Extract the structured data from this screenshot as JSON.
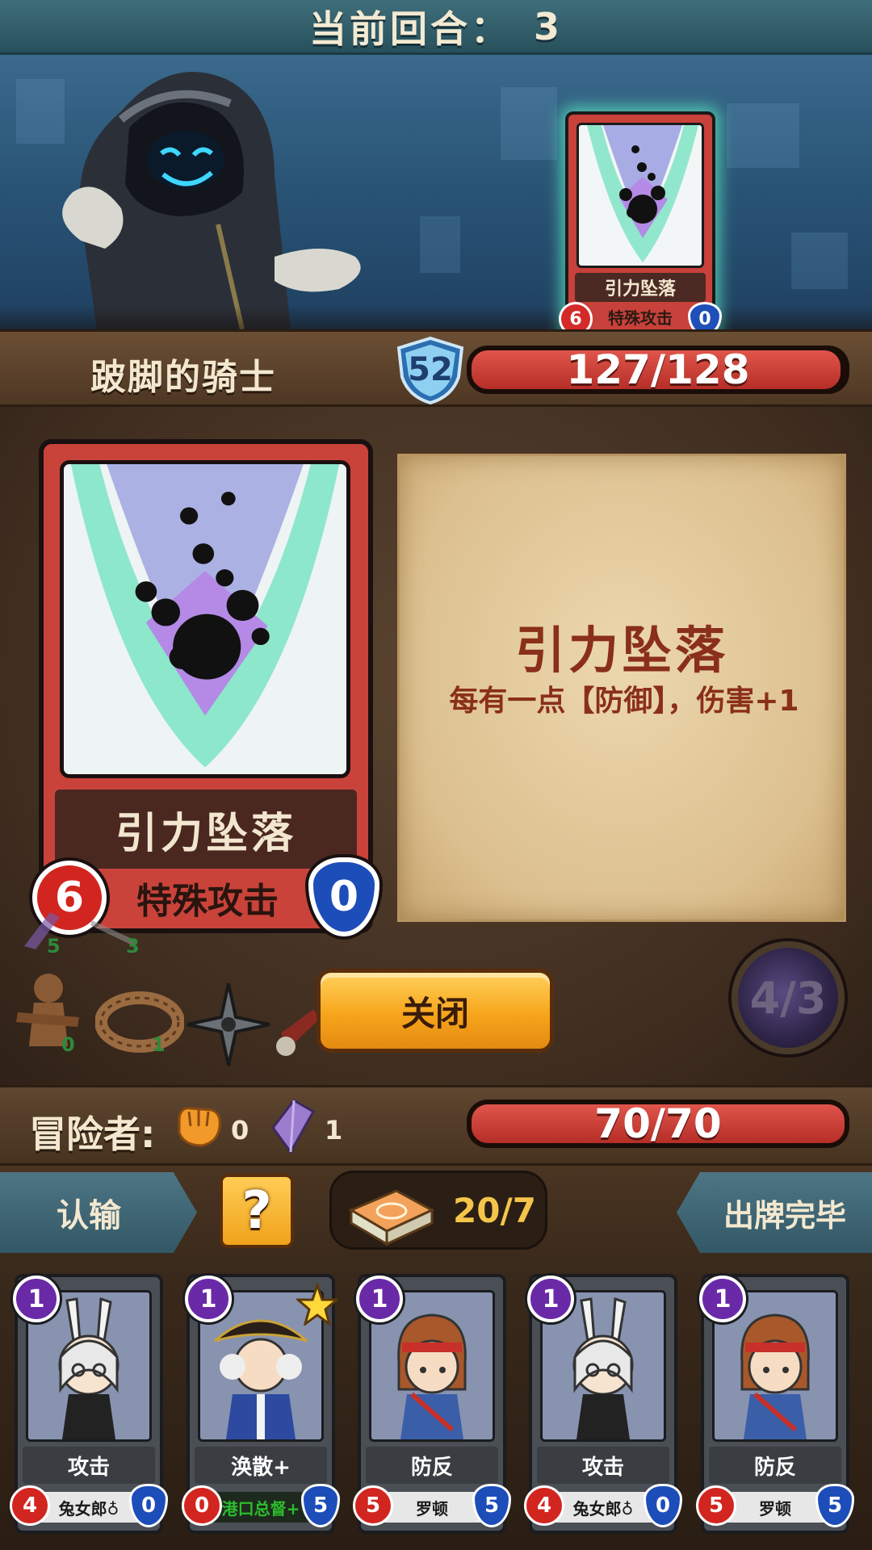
{
  "turn": {
    "label": "当前回合：",
    "value": "3"
  },
  "enemy": {
    "name": "跛脚的骑士",
    "level": "52",
    "hp_text": "127/128",
    "hp_fraction": 0.99,
    "played_card": {
      "name": "引力坠落",
      "type": "特殊攻击",
      "cost": "6",
      "defense": "0"
    }
  },
  "detail": {
    "card": {
      "name": "引力坠落",
      "type": "特殊攻击",
      "cost": "6",
      "defense": "0"
    },
    "title": "引力坠落",
    "description": "每有一点【防御】，伤害+1"
  },
  "items": [
    {
      "icon": "claw-icon",
      "count": "5"
    },
    {
      "icon": "blade-icon",
      "count": "3"
    },
    {
      "icon": "voodoo-doll-icon",
      "count": "0"
    },
    {
      "icon": "rope-coil-icon",
      "count": "1"
    },
    {
      "icon": "shuriken-icon",
      "count": ""
    },
    {
      "icon": "scroll-icon",
      "count": ""
    }
  ],
  "close_button": "关闭",
  "energy": "4/3",
  "player": {
    "label": "冒险者:",
    "fist_count": "0",
    "crystal_count": "1",
    "hp_text": "70/70",
    "hp_fraction": 1.0
  },
  "actions": {
    "surrender": "认输",
    "help": "?",
    "deck_count": "20/7",
    "end_turn": "出牌完毕"
  },
  "hand": [
    {
      "name": "攻击",
      "owner": "兔女郎♁",
      "energy": "1",
      "atk": "4",
      "def": "0",
      "hero": "bunny",
      "star": false
    },
    {
      "name": "涣散+",
      "owner": "港口总督+",
      "energy": "1",
      "atk": "0",
      "def": "5",
      "hero": "governor",
      "star": true
    },
    {
      "name": "防反",
      "owner": "罗顿",
      "energy": "1",
      "atk": "5",
      "def": "5",
      "hero": "roton",
      "star": false
    },
    {
      "name": "攻击",
      "owner": "兔女郎♁",
      "energy": "1",
      "atk": "4",
      "def": "0",
      "hero": "bunny",
      "star": false
    },
    {
      "name": "防反",
      "owner": "罗顿",
      "energy": "1",
      "atk": "5",
      "def": "5",
      "hero": "roton",
      "star": false
    }
  ],
  "colors": {
    "card_red": "#c9433b",
    "hp_red": "#c8362f",
    "energy_purple": "#6a2aa8",
    "defense_blue": "#1d4db9",
    "button_orange": "#f7a51c",
    "teal_banner": "#3f6e7a"
  }
}
